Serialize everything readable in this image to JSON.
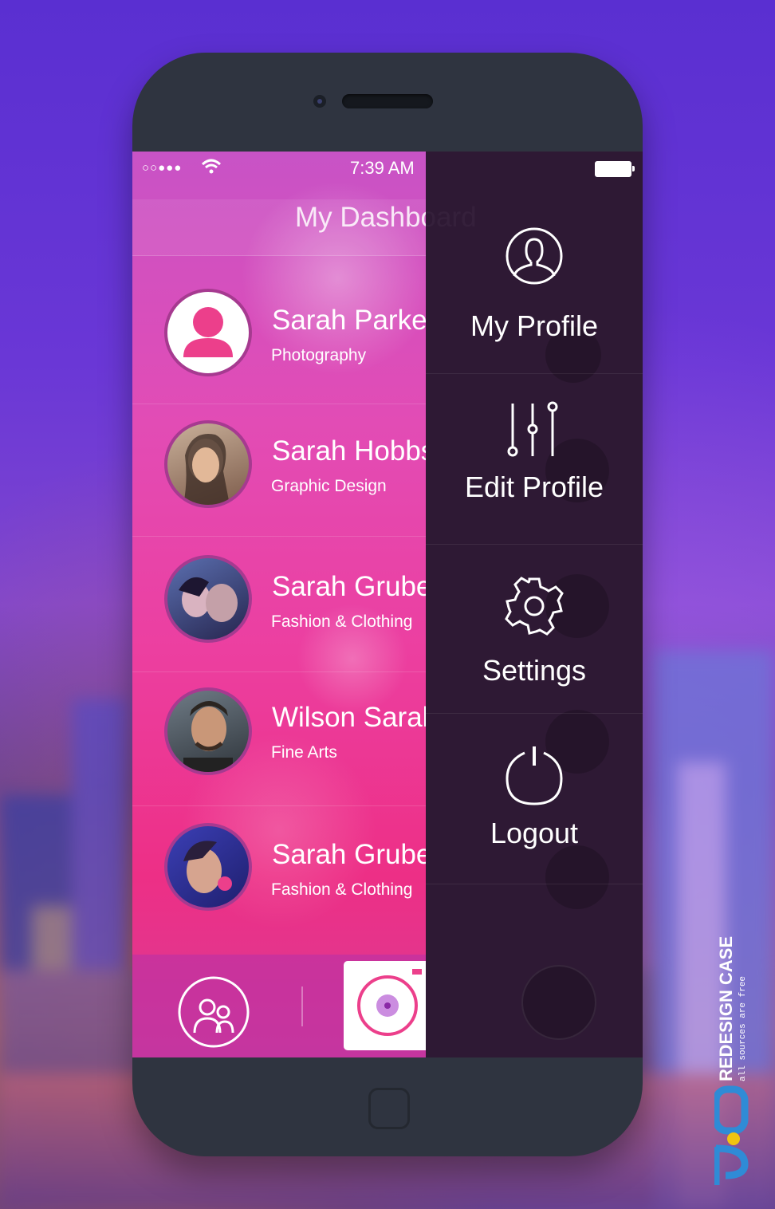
{
  "status_bar": {
    "time": "7:39 AM",
    "signal": "○○●●●"
  },
  "header": {
    "title": "My Dashboard"
  },
  "contacts": [
    {
      "name": "Sarah Parker",
      "field": "Photography"
    },
    {
      "name": "Sarah Hobbs",
      "field": "Graphic Design"
    },
    {
      "name": "Sarah Gruber",
      "field": "Fashion & Clothing"
    },
    {
      "name": "Wilson Sarah",
      "field": "Fine Arts"
    },
    {
      "name": "Sarah Gruber",
      "field": "Fashion & Clothing"
    }
  ],
  "menu": [
    {
      "label": "My Profile",
      "icon": "user-circle-icon"
    },
    {
      "label": "Edit Profile",
      "icon": "sliders-icon"
    },
    {
      "label": "Settings",
      "icon": "gear-icon"
    },
    {
      "label": "Logout",
      "icon": "power-icon"
    }
  ],
  "watermark": {
    "title": "REDESIGN CASE",
    "subtitle": "all sources are free"
  },
  "colors": {
    "accent": "#ec3f96",
    "menu_bg": "#2e1834",
    "phone_body": "#2f3440"
  }
}
